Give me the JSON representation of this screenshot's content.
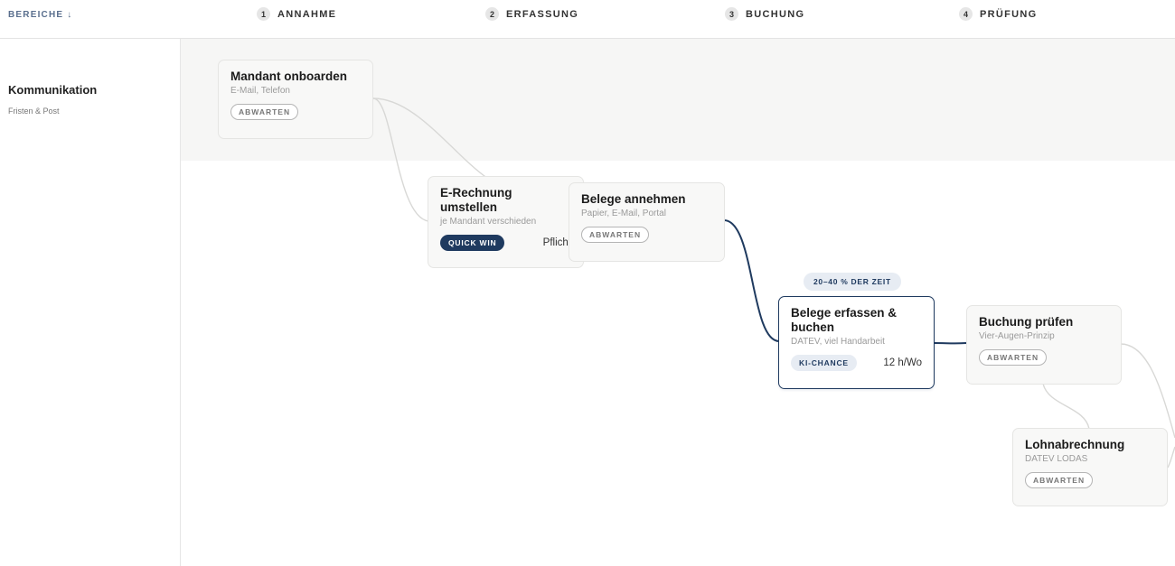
{
  "header": {
    "areas_label": "BEREICHE ↓",
    "stages": [
      {
        "number": "1",
        "label": "ANNAHME"
      },
      {
        "number": "2",
        "label": "ERFASSUNG"
      },
      {
        "number": "3",
        "label": "BUCHUNG"
      },
      {
        "number": "4",
        "label": "PRÜFUNG"
      }
    ]
  },
  "lane": {
    "title": "Kommunikation",
    "subtitle": "Fristen & Post"
  },
  "cards": {
    "mandant": {
      "title": "Mandant onboarden",
      "subtitle": "E-Mail, Telefon",
      "badge": "ABWARTEN"
    },
    "erechnung": {
      "title": "E-Rechnung umstellen",
      "subtitle": "je Mandant verschieden",
      "badge": "QUICK WIN",
      "meta": "Pflicht"
    },
    "belege_annehmen": {
      "title": "Belege annehmen",
      "subtitle": "Papier, E-Mail, Portal",
      "badge": "ABWARTEN"
    },
    "belege_erfassen": {
      "title": "Belege erfassen & buchen",
      "subtitle": "DATEV, viel Handarbeit",
      "badge": "KI-CHANCE",
      "meta": "12 h/Wo",
      "callout": "20–40 % DER ZEIT"
    },
    "buchung_pruefen": {
      "title": "Buchung prüfen",
      "subtitle": "Vier-Augen-Prinzip",
      "badge": "ABWARTEN"
    },
    "lohnabrechnung": {
      "title": "Lohnabrechnung",
      "subtitle": "DATEV LODAS",
      "badge": "ABWARTEN"
    }
  },
  "colors": {
    "accent": "#1f3a5f",
    "link_muted": "#d8d8d6",
    "lane_band": "#f6f6f5"
  }
}
